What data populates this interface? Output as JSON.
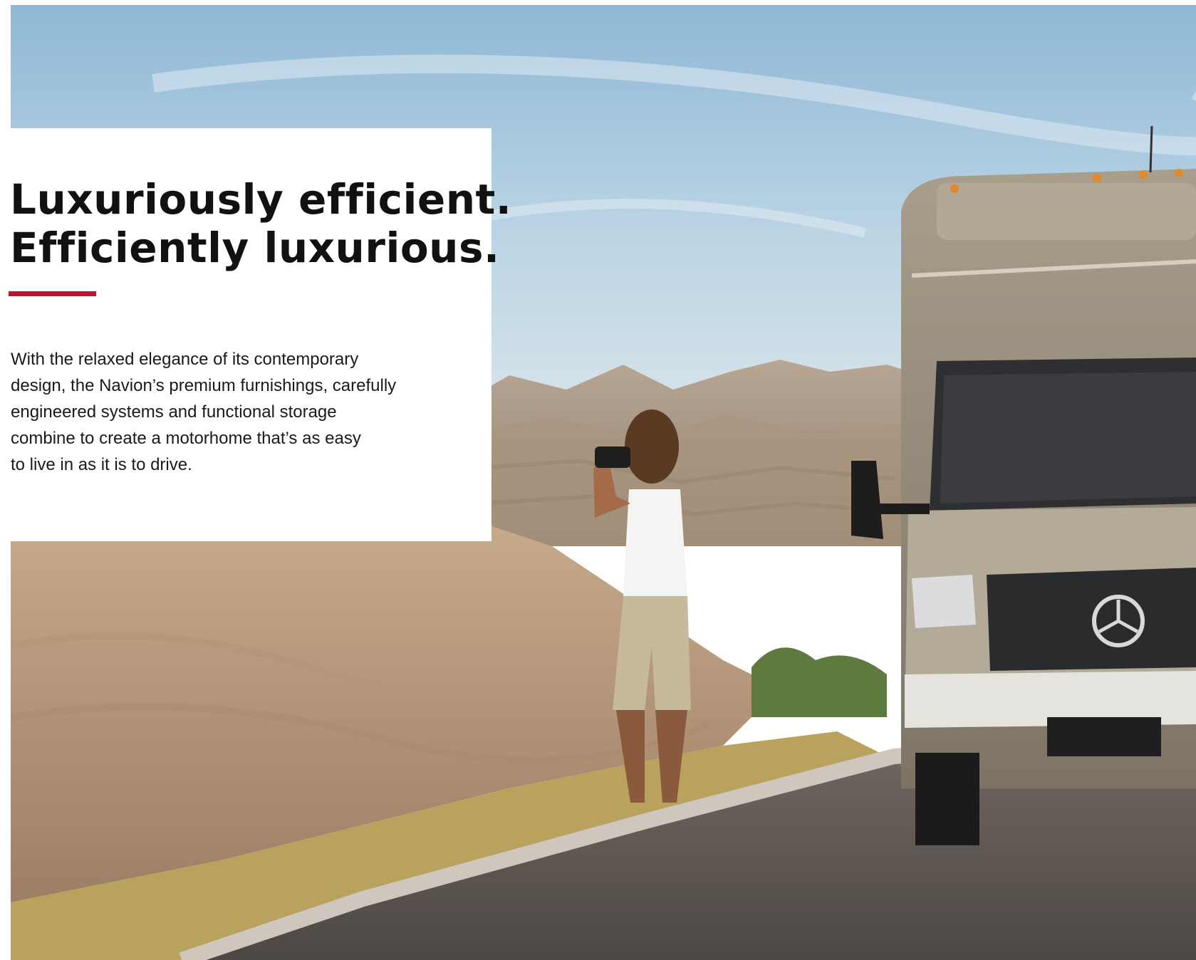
{
  "headline": {
    "line1": "Luxuriously efficient.",
    "line2": "Efficiently luxurious."
  },
  "body": {
    "lines": [
      "With the relaxed elegance of its contemporary",
      "design, the Navion’s premium furnishings, carefully",
      "engineered systems and functional storage",
      "combine to create a motorhome that’s as easy",
      "to live in as it is to drive."
    ]
  },
  "colors": {
    "accent": "#c8102e",
    "text": "#111111",
    "panel": "#ffffff"
  }
}
